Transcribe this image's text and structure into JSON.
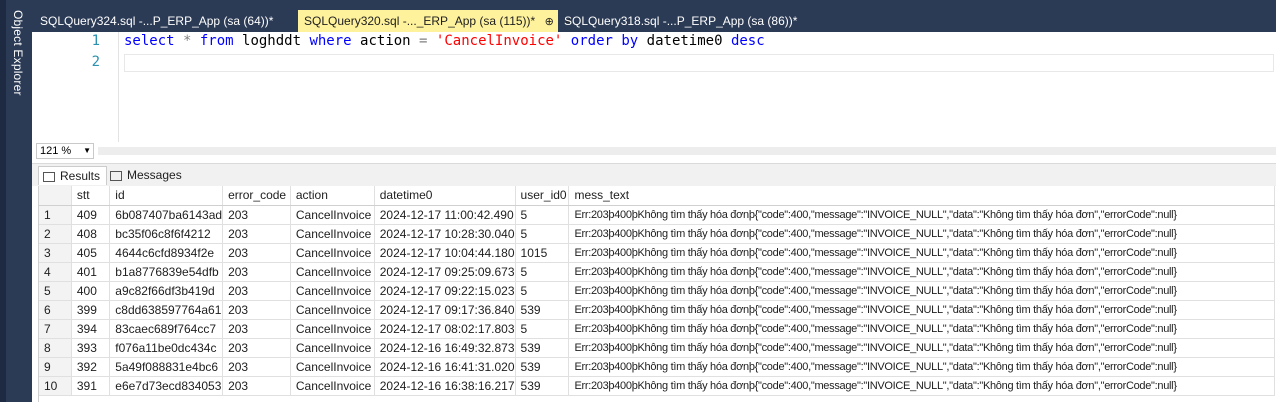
{
  "side_panel": {
    "label": "Object Explorer"
  },
  "doc_tabs": [
    {
      "label": "SQLQuery324.sql -...P_ERP_App (sa (64))*",
      "active": false
    },
    {
      "label": "SQLQuery320.sql -..._ERP_App (sa (115))*",
      "active": true,
      "pin_icon": "⊕",
      "close_icon": "✕"
    },
    {
      "label": "SQLQuery318.sql -...P_ERP_App (sa (86))*",
      "active": false
    }
  ],
  "editor": {
    "line_numbers": [
      "1",
      "2"
    ],
    "tokens": [
      {
        "text": "select",
        "kind": "kw"
      },
      {
        "text": " * ",
        "kind": "gr"
      },
      {
        "text": "from",
        "kind": "kw"
      },
      {
        "text": " loghddt ",
        "kind": "id"
      },
      {
        "text": "where",
        "kind": "kw"
      },
      {
        "text": " action ",
        "kind": "id"
      },
      {
        "text": "=",
        "kind": "gr"
      },
      {
        "text": " ",
        "kind": "id"
      },
      {
        "text": "'CancelInvoice'",
        "kind": "st"
      },
      {
        "text": " ",
        "kind": "id"
      },
      {
        "text": "order by",
        "kind": "kw"
      },
      {
        "text": " datetime0 ",
        "kind": "id"
      },
      {
        "text": "desc",
        "kind": "kw"
      }
    ]
  },
  "zoom": {
    "value": "121 %"
  },
  "result_tabs": [
    {
      "label": "Results",
      "icon": "grid-icon",
      "active": true
    },
    {
      "label": "Messages",
      "icon": "messages-icon",
      "active": false
    }
  ],
  "grid": {
    "columns": [
      "stt",
      "id",
      "error_code",
      "action",
      "datetime0",
      "user_id0",
      "mess_text"
    ],
    "rows": [
      [
        "1",
        "409",
        "6b087407ba6143ad",
        "203",
        "CancelInvoice",
        "2024-12-17 11:00:42.490",
        "5",
        "Err:203þ400þKhông tìm thấy hóa đơnþ{\"code\":400,\"message\":\"INVOICE_NULL\",\"data\":\"Không tìm thấy hóa đơn\",\"errorCode\":null}"
      ],
      [
        "2",
        "408",
        "bc35f06c8f6f4212",
        "203",
        "CancelInvoice",
        "2024-12-17 10:28:30.040",
        "5",
        "Err:203þ400þKhông tìm thấy hóa đơnþ{\"code\":400,\"message\":\"INVOICE_NULL\",\"data\":\"Không tìm thấy hóa đơn\",\"errorCode\":null}"
      ],
      [
        "3",
        "405",
        "4644c6cfd8934f2e",
        "203",
        "CancelInvoice",
        "2024-12-17 10:04:44.180",
        "1015",
        "Err:203þ400þKhông tìm thấy hóa đơnþ{\"code\":400,\"message\":\"INVOICE_NULL\",\"data\":\"Không tìm thấy hóa đơn\",\"errorCode\":null}"
      ],
      [
        "4",
        "401",
        "b1a8776839e54dfb",
        "203",
        "CancelInvoice",
        "2024-12-17 09:25:09.673",
        "5",
        "Err:203þ400þKhông tìm thấy hóa đơnþ{\"code\":400,\"message\":\"INVOICE_NULL\",\"data\":\"Không tìm thấy hóa đơn\",\"errorCode\":null}"
      ],
      [
        "5",
        "400",
        "a9c82f66df3b419d",
        "203",
        "CancelInvoice",
        "2024-12-17 09:22:15.023",
        "5",
        "Err:203þ400þKhông tìm thấy hóa đơnþ{\"code\":400,\"message\":\"INVOICE_NULL\",\"data\":\"Không tìm thấy hóa đơn\",\"errorCode\":null}"
      ],
      [
        "6",
        "399",
        "c8dd638597764a61",
        "203",
        "CancelInvoice",
        "2024-12-17 09:17:36.840",
        "539",
        "Err:203þ400þKhông tìm thấy hóa đơnþ{\"code\":400,\"message\":\"INVOICE_NULL\",\"data\":\"Không tìm thấy hóa đơn\",\"errorCode\":null}"
      ],
      [
        "7",
        "394",
        "83caec689f764cc7",
        "203",
        "CancelInvoice",
        "2024-12-17 08:02:17.803",
        "5",
        "Err:203þ400þKhông tìm thấy hóa đơnþ{\"code\":400,\"message\":\"INVOICE_NULL\",\"data\":\"Không tìm thấy hóa đơn\",\"errorCode\":null}"
      ],
      [
        "8",
        "393",
        "f076a11be0dc434c",
        "203",
        "CancelInvoice",
        "2024-12-16 16:49:32.873",
        "539",
        "Err:203þ400þKhông tìm thấy hóa đơnþ{\"code\":400,\"message\":\"INVOICE_NULL\",\"data\":\"Không tìm thấy hóa đơn\",\"errorCode\":null}"
      ],
      [
        "9",
        "392",
        "5a49f088831e4bc6",
        "203",
        "CancelInvoice",
        "2024-12-16 16:41:31.020",
        "539",
        "Err:203þ400þKhông tìm thấy hóa đơnþ{\"code\":400,\"message\":\"INVOICE_NULL\",\"data\":\"Không tìm thấy hóa đơn\",\"errorCode\":null}"
      ],
      [
        "10",
        "391",
        "e6e7d73ecd834053",
        "203",
        "CancelInvoice",
        "2024-12-16 16:38:16.217",
        "539",
        "Err:203þ400þKhông tìm thấy hóa đơnþ{\"code\":400,\"message\":\"INVOICE_NULL\",\"data\":\"Không tìm thấy hóa đơn\",\"errorCode\":null}"
      ]
    ]
  }
}
